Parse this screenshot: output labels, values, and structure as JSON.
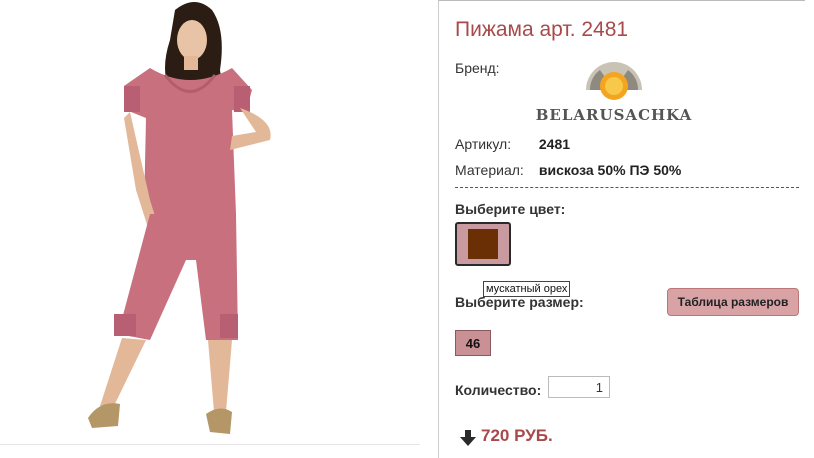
{
  "product": {
    "title": "Пижама арт. 2481",
    "brand_label": "Бренд:",
    "brand_name": "BELARUSACHKA",
    "article_label": "Артикул:",
    "article_value": "2481",
    "material_label": "Материал:",
    "material_value": "вискоза 50% ПЭ 50%"
  },
  "color": {
    "label": "Выберите цвет:",
    "swatch_hex": "#6b2f06",
    "tooltip": "мускатный орех"
  },
  "size": {
    "label": "Выберите размер:",
    "table_button": "Таблица размеров",
    "options": [
      "46"
    ]
  },
  "quantity": {
    "label": "Количество:",
    "value": "1"
  },
  "price": {
    "text": "720 РУБ.",
    "icon": "arrow-down-icon"
  },
  "colors": {
    "accent": "#a94a4a",
    "button_bg": "#d9a3a6",
    "pajama": "#c8707e"
  }
}
